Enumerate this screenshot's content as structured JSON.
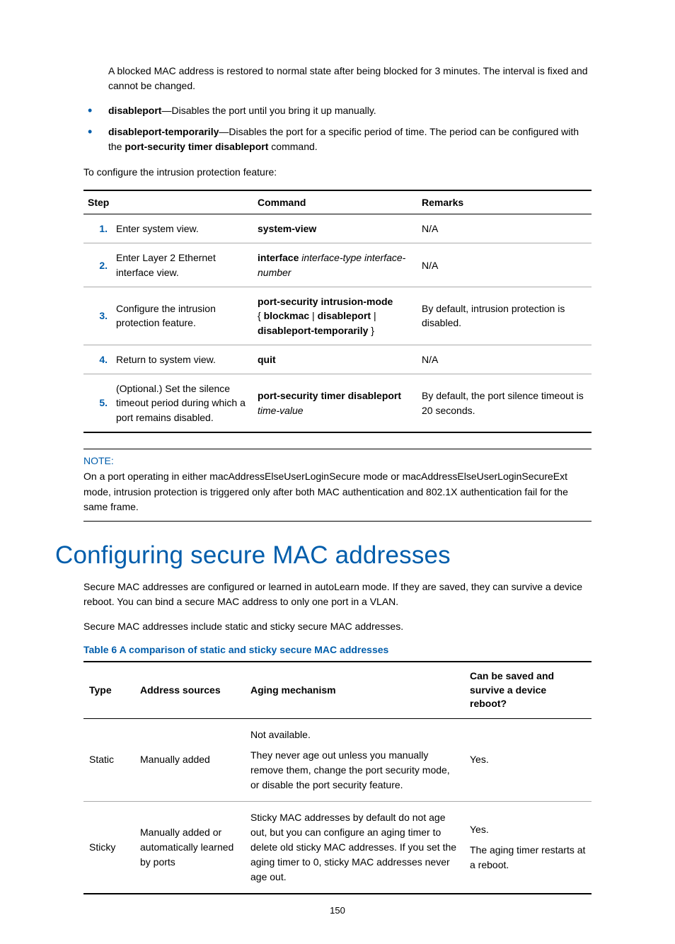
{
  "intro": {
    "blocked_mac": "A blocked MAC address is restored to normal state after being blocked for 3 minutes. The interval is fixed and cannot be changed."
  },
  "bullets": [
    {
      "term": "disableport",
      "desc": "—Disables the port until you bring it up manually."
    },
    {
      "term": "disableport-temporarily",
      "desc_pre": "—Disables the port for a specific period of time. The period can be configured with the ",
      "cmd": "port-security timer disableport",
      "desc_post": " command."
    }
  ],
  "configure_lead": "To configure the intrusion protection feature:",
  "steps_table": {
    "headers": {
      "step": "Step",
      "command": "Command",
      "remarks": "Remarks"
    },
    "rows": [
      {
        "num": "1.",
        "action": "Enter system view.",
        "cmd_bold": "system-view",
        "remarks": "N/A"
      },
      {
        "num": "2.",
        "action": "Enter Layer 2 Ethernet interface view.",
        "cmd_bold": "interface",
        "cmd_ital": " interface-type interface-number",
        "remarks": "N/A"
      },
      {
        "num": "3.",
        "action": "Configure the intrusion protection feature.",
        "cmd_l1": "port-security intrusion-mode",
        "cmd_l2_open": "{ ",
        "cmd_l2_b1": "blockmac",
        "cmd_l2_sep1": " | ",
        "cmd_l2_b2": "disableport",
        "cmd_l2_sep2": " | ",
        "cmd_l3_b": "disableport-temporarily",
        "cmd_l3_close": " }",
        "remarks": "By default, intrusion protection is disabled."
      },
      {
        "num": "4.",
        "action": "Return to system view.",
        "cmd_bold": "quit",
        "remarks": "N/A"
      },
      {
        "num": "5.",
        "action": "(Optional.) Set the silence timeout period during which a port remains disabled.",
        "cmd_bold": "port-security timer disableport",
        "cmd_ital": " time-value",
        "remarks": "By default, the port silence timeout is 20 seconds."
      }
    ]
  },
  "note": {
    "label": "NOTE:",
    "body": "On a port operating in either macAddressElseUserLoginSecure mode or macAddressElseUserLoginSecureExt mode, intrusion protection is triggered only after both MAC authentication and 802.1X authentication fail for the same frame."
  },
  "heading": "Configuring secure MAC addresses",
  "section_para1": "Secure MAC addresses are configured or learned in autoLearn mode. If they are saved, they can survive a device reboot. You can bind a secure MAC address to only one port in a VLAN.",
  "section_para2": "Secure MAC addresses include static and sticky secure MAC addresses.",
  "table_caption": "Table 6 A comparison of static and sticky secure MAC addresses",
  "compare_table": {
    "headers": {
      "type": "Type",
      "sources": "Address sources",
      "aging": "Aging mechanism",
      "reboot": "Can be saved and survive a device reboot?"
    },
    "rows": [
      {
        "type": "Static",
        "sources": "Manually added",
        "aging_l1": "Not available.",
        "aging_l2": "They never age out unless you manually remove them, change the port security mode, or disable the port security feature.",
        "reboot": "Yes."
      },
      {
        "type": "Sticky",
        "sources": "Manually added or automatically learned by ports",
        "aging": "Sticky MAC addresses by default do not age out, but you can configure an aging timer to delete old sticky MAC addresses. If you set the aging timer to 0, sticky MAC addresses never age out.",
        "reboot_l1": "Yes.",
        "reboot_l2": "The aging timer restarts at a reboot."
      }
    ]
  },
  "page_number": "150"
}
